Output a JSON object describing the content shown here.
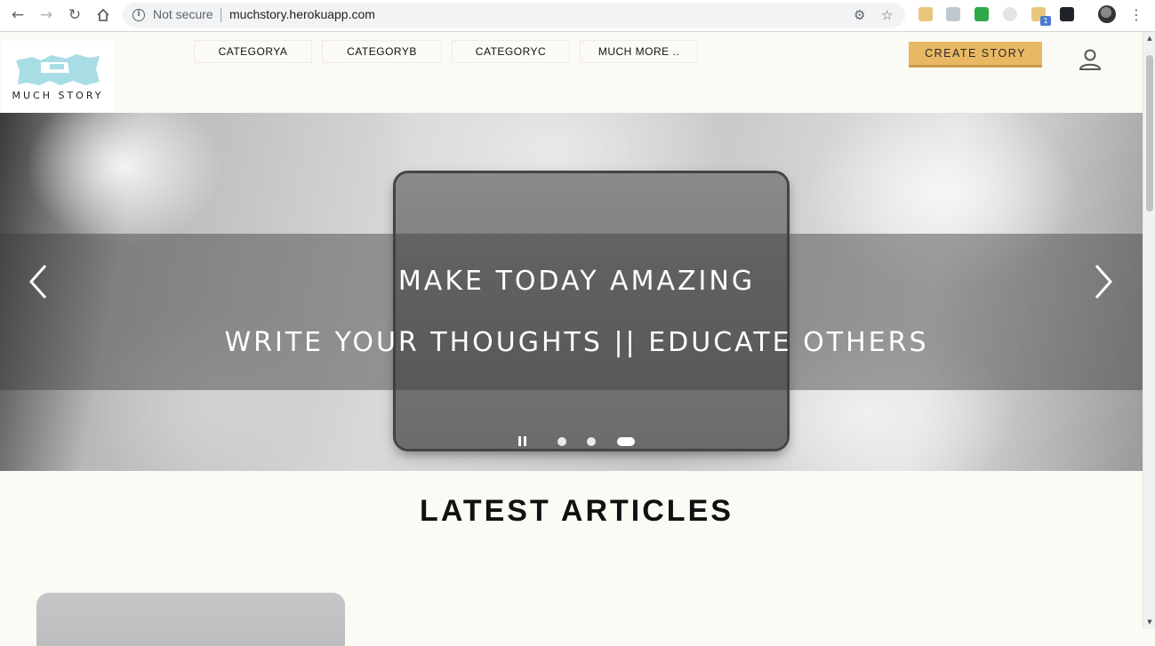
{
  "browser": {
    "security_text": "Not secure",
    "url": "muchstory.herokuapp.com"
  },
  "site": {
    "logo_text": "MUCH STORY",
    "nav": [
      {
        "label": "CATEGORYA"
      },
      {
        "label": "CATEGORYB"
      },
      {
        "label": "CATEGORYC"
      },
      {
        "label": "MUCH MORE .."
      }
    ],
    "create_story_label": "CREATE STORY"
  },
  "hero": {
    "headline": "MAKE TODAY AMAZING",
    "subheadline": "WRITE YOUR THOUGHTS || EDUCATE OTHERS",
    "slides_count": 3,
    "active_slide": 3
  },
  "section": {
    "title": "LATEST ARTICLES"
  },
  "colors": {
    "accent": "#e8b864",
    "page_bg": "#fbfaf5",
    "logo_color": "#a9dde6"
  }
}
